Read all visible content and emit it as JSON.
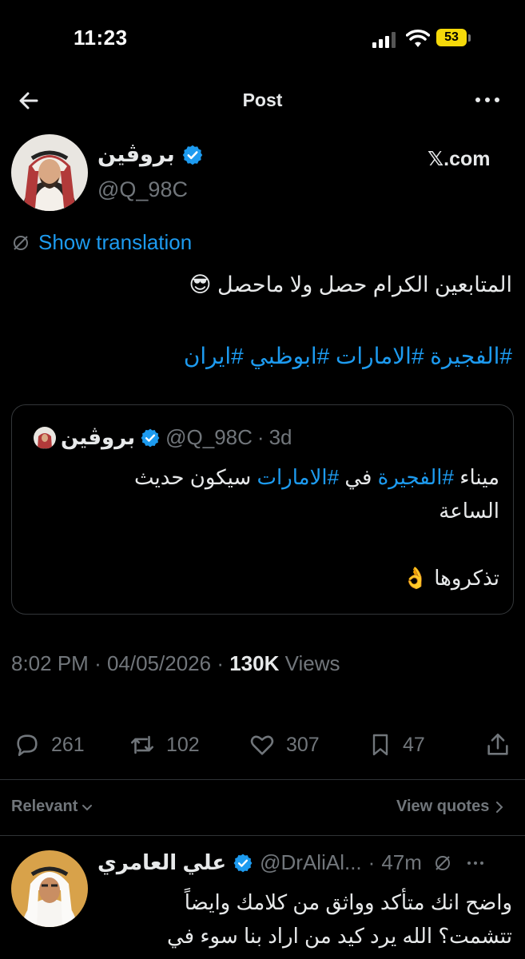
{
  "status_bar": {
    "time": "11:23",
    "battery": "53"
  },
  "header": {
    "title": "Post"
  },
  "author": {
    "name": "بروڤين",
    "handle": "@Q_98C",
    "watermark": "𝕏.com"
  },
  "translate": {
    "label": "Show translation"
  },
  "post": {
    "text": "المتابعين الكرام حصل ولا ماحصل 😎",
    "hashtags": [
      "#الفجيرة",
      "#الامارات",
      "#ابوظبي",
      "#ايران"
    ]
  },
  "quote": {
    "name": "بروڤين",
    "handle": "@Q_98C",
    "time": "3d",
    "line1_a": "ميناء ",
    "line1_tag1": "#الفجيرة",
    "line1_b": " في ",
    "line1_tag2": "#الامارات",
    "line1_c": " سيكون حديث",
    "line2": "الساعة",
    "line3": "تذكروها 👌"
  },
  "meta": {
    "time": "8:02 PM",
    "date": "04/05/2026",
    "views_count": "130K",
    "views_label": "Views"
  },
  "actions": {
    "replies": "261",
    "reposts": "102",
    "likes": "307",
    "bookmarks": "47"
  },
  "sort": {
    "relevant": "Relevant",
    "view_quotes": "View quotes"
  },
  "reply": {
    "name": "علي العامري",
    "handle": "@DrAliAl...",
    "time": "47m",
    "line1": "واضح انك متأكد وواثق من كلامك وايضاً",
    "line2": "تتشمت؟ الله يرد كيد من اراد بنا سوء في"
  },
  "colors": {
    "accent": "#1d9bf0",
    "muted": "#71767b",
    "text": "#e7e9ea",
    "battery": "#f5d90a"
  }
}
